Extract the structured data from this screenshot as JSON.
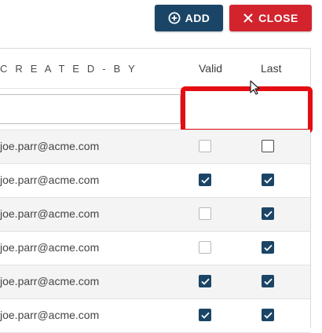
{
  "toolbar": {
    "add_label": "ADD",
    "close_label": "CLOSE",
    "add_icon": "plus-circle-icon",
    "close_icon": "close-icon",
    "add_color": "#1b4566",
    "close_color": "#d3242e"
  },
  "table": {
    "columns": {
      "created_by": "C R E A T E D - B Y",
      "valid": "Valid",
      "last": "Last"
    },
    "filter": {
      "created_by_value": "",
      "valid_value": "",
      "highlight_color": "#e40d13"
    },
    "rows": [
      {
        "email": "joe.parr@acme.com",
        "valid": false,
        "last": false
      },
      {
        "email": "joe.parr@acme.com",
        "valid": true,
        "last": true
      },
      {
        "email": "joe.parr@acme.com",
        "valid": false,
        "last": true
      },
      {
        "email": "joe.parr@acme.com",
        "valid": false,
        "last": true
      },
      {
        "email": "joe.parr@acme.com",
        "valid": true,
        "last": true
      },
      {
        "email": "joe.parr@acme.com",
        "valid": true,
        "last": true
      }
    ],
    "checkbox_color": "#1b4566"
  }
}
